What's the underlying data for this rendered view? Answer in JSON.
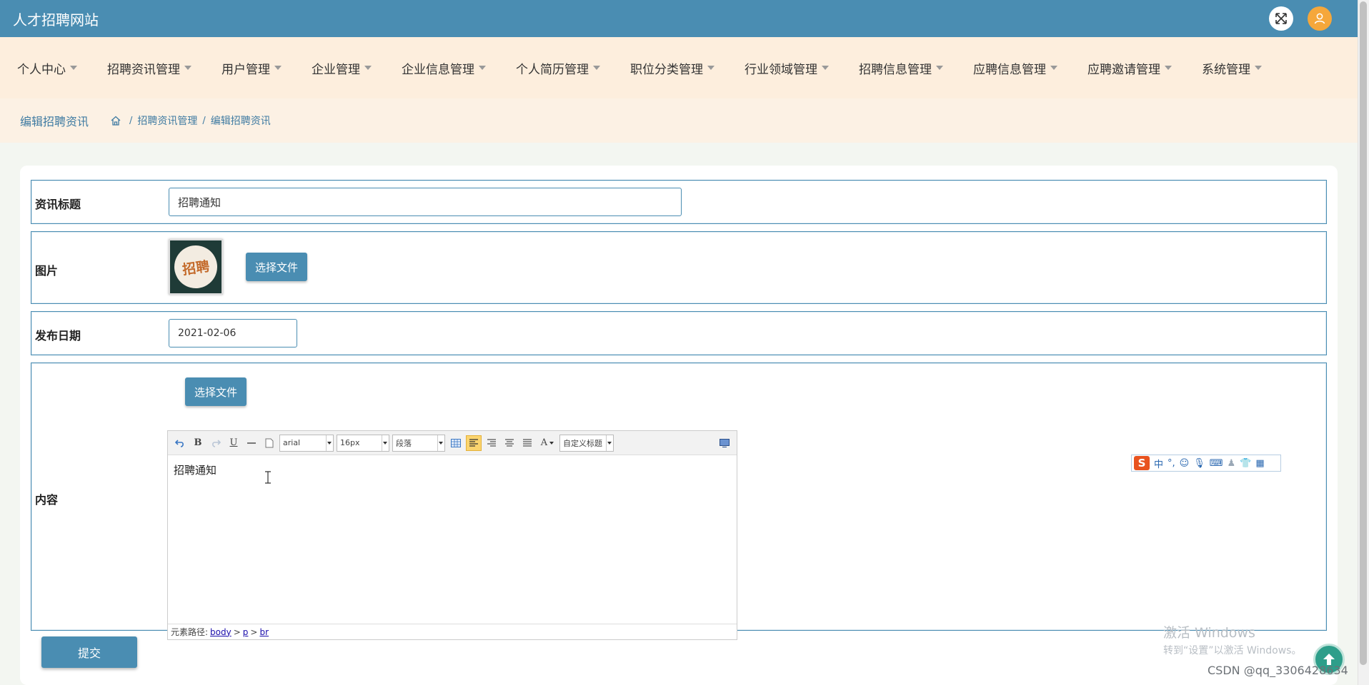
{
  "header": {
    "site_title": "人才招聘网站"
  },
  "nav": {
    "items": [
      "个人中心",
      "招聘资讯管理",
      "用户管理",
      "企业管理",
      "企业信息管理",
      "个人简历管理",
      "职位分类管理",
      "行业领域管理",
      "招聘信息管理",
      "应聘信息管理",
      "应聘邀请管理",
      "系统管理"
    ]
  },
  "breadcrumb": {
    "title": "编辑招聘资讯",
    "path": [
      "招聘资讯管理",
      "编辑招聘资讯"
    ],
    "separator": "/"
  },
  "form": {
    "title_label": "资讯标题",
    "title_value": "招聘通知",
    "image_label": "图片",
    "image_thumb_text": "招聘",
    "choose_file": "选择文件",
    "date_label": "发布日期",
    "date_value": "2021-02-06",
    "content_label": "内容",
    "submit": "提交"
  },
  "editor": {
    "font_family": "arial",
    "font_size": "16px",
    "paragraph": "段落",
    "custom_title": "自定义标题",
    "font_color_glyph": "A",
    "content": "招聘通知",
    "path_label": "元素路径:",
    "path": [
      "body",
      "p",
      "br"
    ],
    "path_separator": ">"
  },
  "ime": {
    "logo": "S",
    "mode": "中"
  },
  "watermark": {
    "line1": "激活 Windows",
    "line2": "转到“设置”以激活 Windows。"
  },
  "footer": {
    "csdn": "CSDN @qq_3306428634"
  },
  "colors": {
    "primary": "#4a8db2",
    "nav_bg": "#fdeedd",
    "accent": "#f5a73b"
  }
}
